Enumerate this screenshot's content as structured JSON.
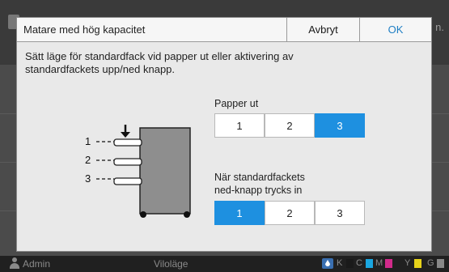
{
  "background": {
    "header_right_text": "n.",
    "status_user": "Admin",
    "status_mode": "Viloläge",
    "ink": [
      {
        "label": "K",
        "color": "#1a1a1a"
      },
      {
        "label": "C",
        "color": "#1aa6e0"
      },
      {
        "label": "M",
        "color": "#d12a8a"
      },
      {
        "label": "Y",
        "color": "#e6d21a"
      },
      {
        "label": "G",
        "color": "#888888"
      }
    ]
  },
  "dialog": {
    "title": "Matare med hög kapacitet",
    "cancel_label": "Avbryt",
    "ok_label": "OK",
    "description": "Sätt läge för standardfack vid papper ut eller aktivering av standardfackets upp/ned knapp.",
    "tray_labels": [
      "1",
      "2",
      "3"
    ],
    "paper_out": {
      "label": "Papper ut",
      "options": [
        "1",
        "2",
        "3"
      ],
      "selected": "3"
    },
    "down_button": {
      "label_line1": "När standardfackets",
      "label_line2": "ned-knapp trycks in",
      "options": [
        "1",
        "2",
        "3"
      ],
      "selected": "1"
    }
  }
}
